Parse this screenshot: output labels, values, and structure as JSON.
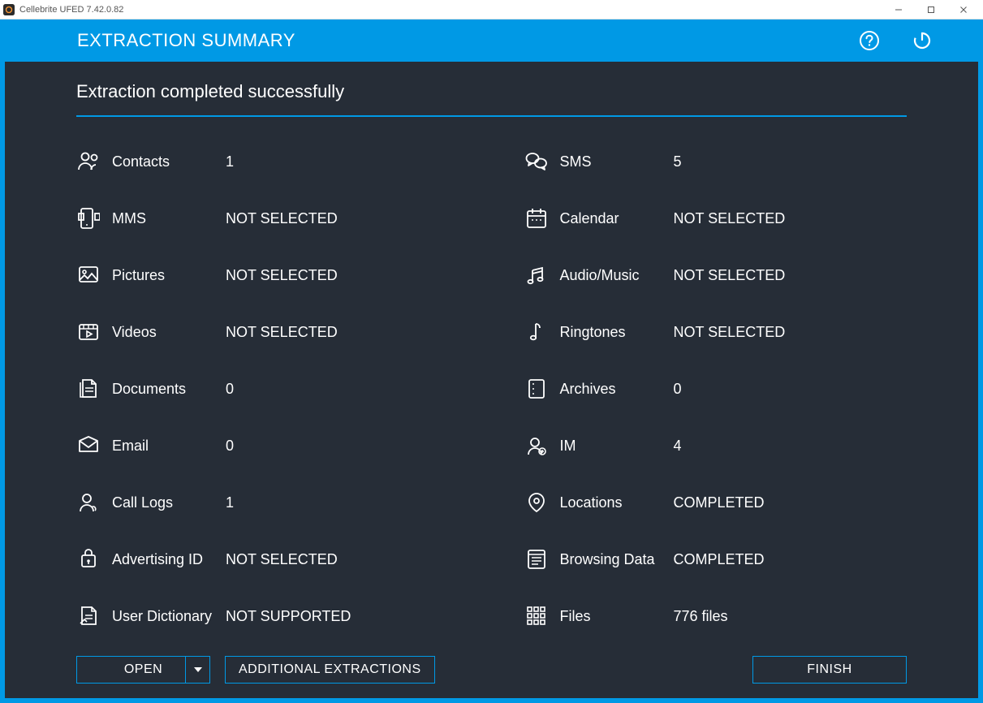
{
  "window": {
    "title": "Cellebrite UFED 7.42.0.82"
  },
  "header": {
    "title": "EXTRACTION SUMMARY"
  },
  "subtitle": "Extraction completed successfully",
  "items": [
    {
      "label": "Contacts",
      "value": "1",
      "icon": "contacts"
    },
    {
      "label": "SMS",
      "value": "5",
      "icon": "sms"
    },
    {
      "label": "MMS",
      "value": "NOT SELECTED",
      "icon": "mms"
    },
    {
      "label": "Calendar",
      "value": "NOT SELECTED",
      "icon": "calendar"
    },
    {
      "label": "Pictures",
      "value": "NOT SELECTED",
      "icon": "pictures"
    },
    {
      "label": "Audio/Music",
      "value": "NOT SELECTED",
      "icon": "audio"
    },
    {
      "label": "Videos",
      "value": "NOT SELECTED",
      "icon": "videos"
    },
    {
      "label": "Ringtones",
      "value": "NOT SELECTED",
      "icon": "ringtones"
    },
    {
      "label": "Documents",
      "value": "0",
      "icon": "documents"
    },
    {
      "label": "Archives",
      "value": "0",
      "icon": "archives"
    },
    {
      "label": "Email",
      "value": "0",
      "icon": "email"
    },
    {
      "label": "IM",
      "value": "4",
      "icon": "im"
    },
    {
      "label": "Call Logs",
      "value": "1",
      "icon": "calllogs"
    },
    {
      "label": "Locations",
      "value": "COMPLETED",
      "icon": "locations"
    },
    {
      "label": "Advertising ID",
      "value": "NOT SELECTED",
      "icon": "advertising"
    },
    {
      "label": "Browsing Data",
      "value": "COMPLETED",
      "icon": "browsing"
    },
    {
      "label": "User Dictionary",
      "value": "NOT SUPPORTED",
      "icon": "dictionary"
    },
    {
      "label": "Files",
      "value": "776 files",
      "icon": "files"
    }
  ],
  "footer": {
    "open": "OPEN",
    "additional": "ADDITIONAL EXTRACTIONS",
    "finish": "FINISH"
  }
}
